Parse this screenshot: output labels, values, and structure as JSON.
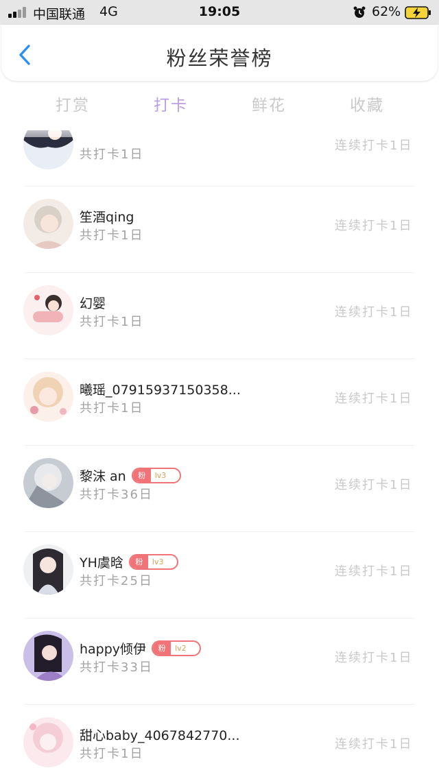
{
  "status_bar": {
    "carrier": "中国联通",
    "network": "4G",
    "time": "19:05",
    "battery": "62%"
  },
  "header": {
    "title": "粉丝荣誉榜"
  },
  "tabs": [
    {
      "label": "打赏",
      "active": false
    },
    {
      "label": "打卡",
      "active": true
    },
    {
      "label": "鲜花",
      "active": false
    },
    {
      "label": "收藏",
      "active": false
    }
  ],
  "colors": {
    "active_tab": "#b99de6",
    "back_icon": "#2c8ff2",
    "badge": "#f07477"
  },
  "list": [
    {
      "name": "",
      "days": "共打卡1日",
      "streak": "连续打卡1日",
      "avatar": "avatar-image",
      "badge": null
    },
    {
      "name": "笙酒qing",
      "days": "共打卡1日",
      "streak": "连续打卡1日",
      "avatar": "avatar-image",
      "badge": null
    },
    {
      "name": "幻婴",
      "days": "共打卡1日",
      "streak": "连续打卡1日",
      "avatar": "avatar-image",
      "badge": null
    },
    {
      "name": "曦瑶_07915937150358...",
      "days": "共打卡1日",
      "streak": "连续打卡1日",
      "avatar": "avatar-image",
      "badge": null
    },
    {
      "name": "黎沫 an",
      "days": "共打卡36日",
      "streak": "连续打卡1日",
      "avatar": "avatar-image",
      "badge": {
        "tag": "粉",
        "level": "lv3"
      }
    },
    {
      "name": "YH虞晗",
      "days": "共打卡25日",
      "streak": "连续打卡1日",
      "avatar": "avatar-image",
      "badge": {
        "tag": "粉",
        "level": "lv3"
      }
    },
    {
      "name": "happy倾伊",
      "days": "共打卡33日",
      "streak": "连续打卡1日",
      "avatar": "avatar-image",
      "badge": {
        "tag": "粉",
        "level": "lv2"
      }
    },
    {
      "name": "甜心baby_4067842770...",
      "days": "共打卡1日",
      "streak": "连续打卡1日",
      "avatar": "avatar-image",
      "badge": null
    }
  ]
}
